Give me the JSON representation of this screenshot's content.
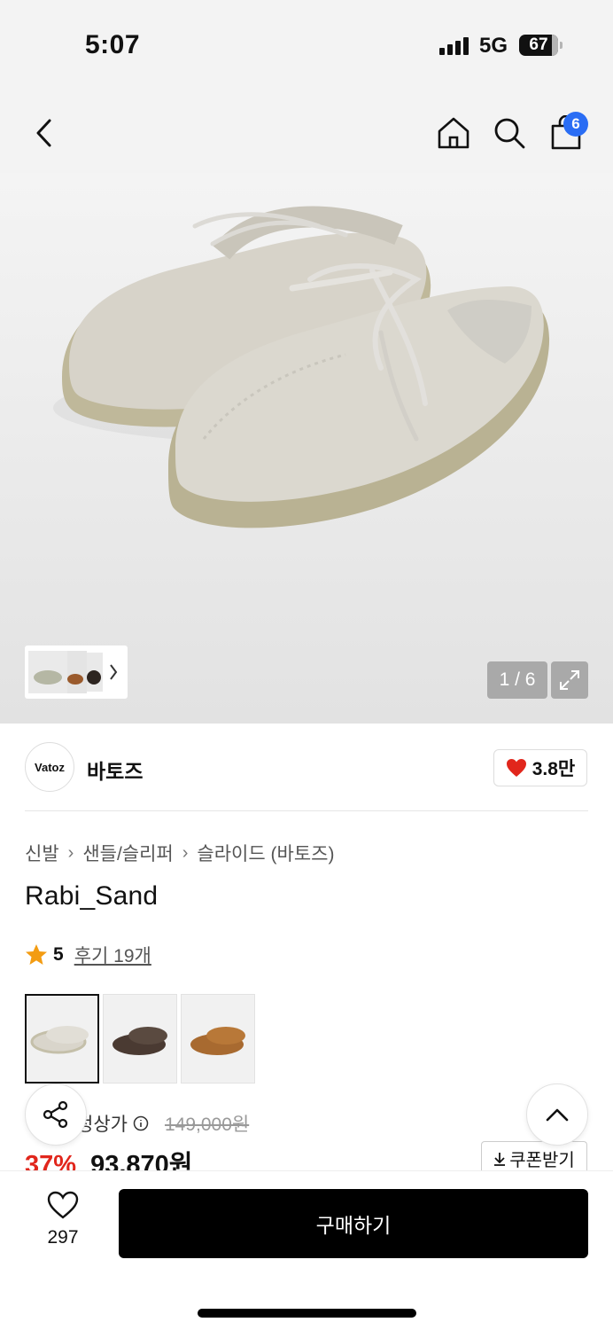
{
  "status": {
    "time": "5:07",
    "network": "5G",
    "battery": "67"
  },
  "nav": {
    "back_icon": "chevron-left-icon",
    "home_icon": "home-icon",
    "search_icon": "search-icon",
    "cart_icon": "shopping-bag-icon",
    "cart_count": "6"
  },
  "gallery": {
    "counter": "1 / 6",
    "expand_icon": "expand-icon"
  },
  "brand": {
    "logo_text": "Vatoz",
    "name": "바토즈",
    "likes": "3.8만"
  },
  "breadcrumb": [
    "신발",
    "샌들/슬리퍼",
    "슬라이드 (바토즈)"
  ],
  "product": {
    "title": "Rabi_Sand",
    "rating": "5",
    "reviews": "후기 19개",
    "price_label": "정상가",
    "original_price": "149,000원",
    "discount": "37%",
    "sale_price": "93,870원",
    "coupon": "쿠폰받기"
  },
  "swatches": [
    {
      "name": "sand",
      "color": "#d9d5cb"
    },
    {
      "name": "brown",
      "color": "#4a3a32"
    },
    {
      "name": "tan",
      "color": "#a86a30"
    }
  ],
  "bottom": {
    "wish_count": "297",
    "buy_label": "구매하기"
  },
  "colors": {
    "accent_red": "#e1261c",
    "badge_blue": "#2a6df4"
  }
}
